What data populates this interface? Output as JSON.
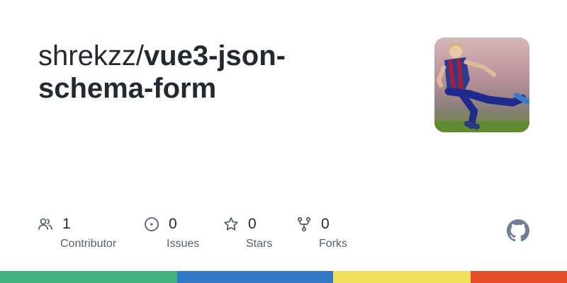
{
  "repo": {
    "owner": "shrekzz/",
    "name_line1": "vue3-json-",
    "name_line2": "schema-form"
  },
  "stats": [
    {
      "icon": "people-icon",
      "count": "1",
      "label": "Contributor"
    },
    {
      "icon": "issue-icon",
      "count": "0",
      "label": "Issues"
    },
    {
      "icon": "star-icon",
      "count": "0",
      "label": "Stars"
    },
    {
      "icon": "fork-icon",
      "count": "0",
      "label": "Forks"
    }
  ],
  "language_bar": [
    {
      "color": "#3fb27f",
      "fraction": 0.313
    },
    {
      "color": "#3178c6",
      "fraction": 0.275
    },
    {
      "color": "#f1e05a",
      "fraction": 0.242
    },
    {
      "color": "#e34c26",
      "fraction": 0.17
    }
  ],
  "icons": {
    "avatar": "avatar-image",
    "logo": "github-logo-icon"
  }
}
